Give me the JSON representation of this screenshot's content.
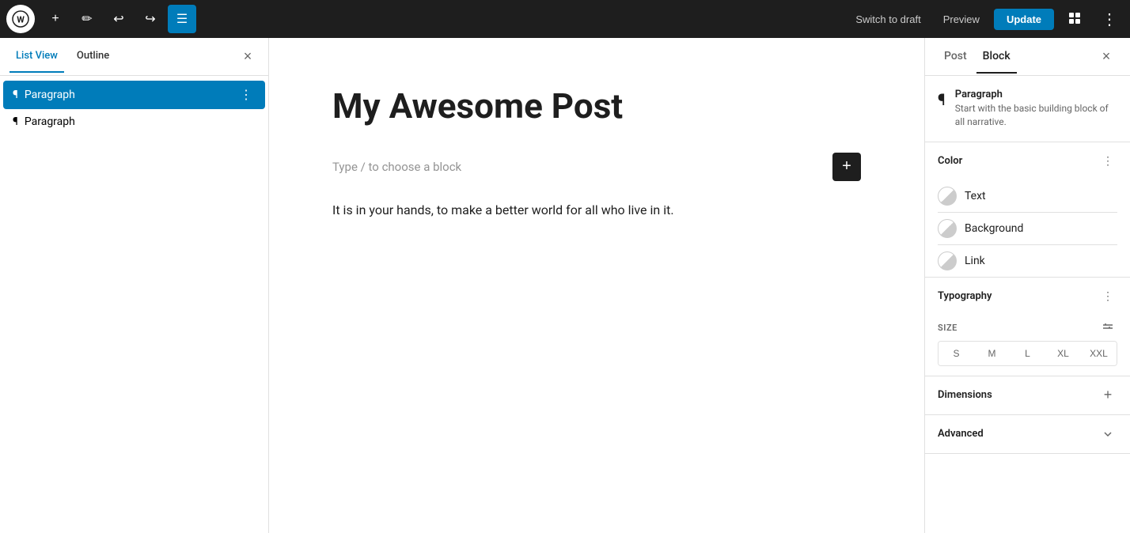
{
  "toolbar": {
    "add_label": "+",
    "edit_icon": "✏",
    "undo_icon": "↩",
    "redo_icon": "↪",
    "list_icon": "≡",
    "switch_to_draft": "Switch to draft",
    "preview": "Preview",
    "update": "Update",
    "settings_icon": "⬛",
    "more_icon": "⋮"
  },
  "left_panel": {
    "tab_list_view": "List View",
    "tab_outline": "Outline",
    "close_icon": "×",
    "items": [
      {
        "label": "Paragraph",
        "selected": true
      },
      {
        "label": "Paragraph",
        "selected": false
      }
    ]
  },
  "content": {
    "title": "My Awesome Post",
    "placeholder": "Type / to choose a block",
    "body": "It is in your hands, to make a better world for all who live in it."
  },
  "right_panel": {
    "tab_post": "Post",
    "tab_block": "Block",
    "close_icon": "×",
    "block_name": "Paragraph",
    "block_description": "Start with the basic building block of all narrative.",
    "color_section": {
      "title": "Color",
      "options": [
        {
          "label": "Text"
        },
        {
          "label": "Background"
        },
        {
          "label": "Link"
        }
      ]
    },
    "typography_section": {
      "title": "Typography",
      "size_label": "SIZE",
      "sizes": [
        "S",
        "M",
        "L",
        "XL",
        "XXL"
      ]
    },
    "dimensions_section": {
      "title": "Dimensions"
    },
    "advanced_section": {
      "title": "Advanced"
    }
  }
}
